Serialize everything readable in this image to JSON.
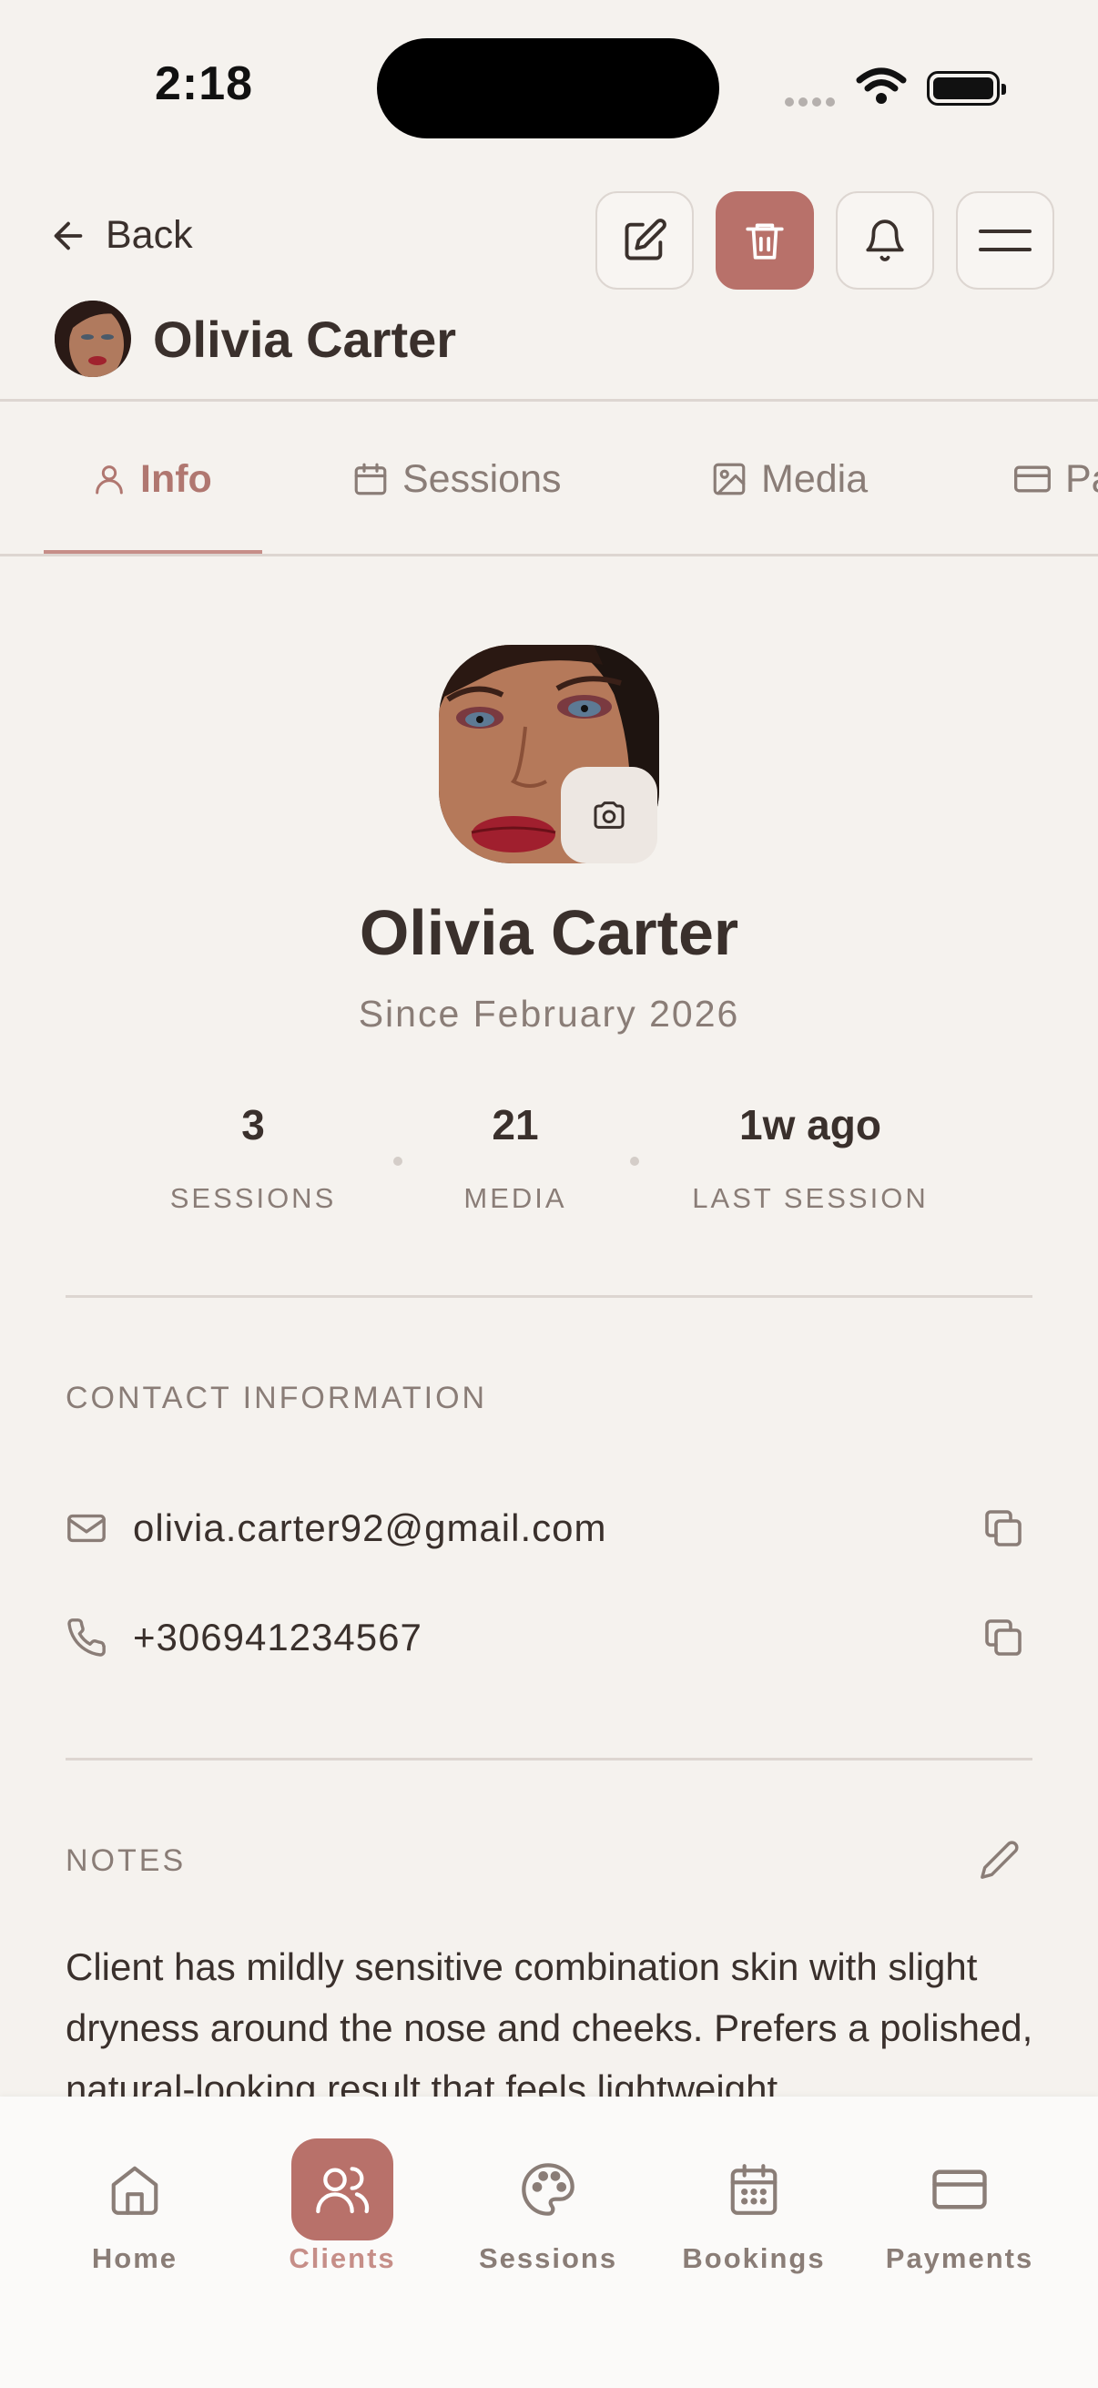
{
  "status_bar": {
    "time": "2:18"
  },
  "header": {
    "back_label": "Back",
    "client_name": "Olivia Carter",
    "actions": [
      "edit-icon",
      "trash-icon",
      "bell-icon",
      "menu-icon"
    ]
  },
  "tabs": [
    {
      "label": "Info",
      "icon": "user-icon",
      "active": true
    },
    {
      "label": "Sessions",
      "icon": "calendar-icon"
    },
    {
      "label": "Media",
      "icon": "image-icon"
    },
    {
      "label": "Pa",
      "icon": "card-icon"
    }
  ],
  "profile": {
    "name": "Olivia Carter",
    "since": "Since February 2026"
  },
  "stats": [
    {
      "value": "3",
      "label": "SESSIONS"
    },
    {
      "value": "21",
      "label": "MEDIA"
    },
    {
      "value": "1w ago",
      "label": "LAST SESSION"
    }
  ],
  "contact": {
    "title": "CONTACT INFORMATION",
    "email": "olivia.carter92@gmail.com",
    "phone": "+306941234567"
  },
  "notes": {
    "title": "NOTES",
    "text": "Client has mildly sensitive combination skin with slight dryness around the nose and cheeks. Prefers a polished, natural-looking result that feels lightweight"
  },
  "bottom_nav": [
    {
      "label": "Home",
      "icon": "home-icon"
    },
    {
      "label": "Clients",
      "icon": "users-icon",
      "active": true
    },
    {
      "label": "Sessions",
      "icon": "palette-icon"
    },
    {
      "label": "Bookings",
      "icon": "calendar-grid-icon"
    },
    {
      "label": "Payments",
      "icon": "card-icon"
    }
  ],
  "colors": {
    "accent": "#b8716a",
    "background": "#f5f2ee",
    "text": "#3a302c",
    "muted": "#8a7d77"
  }
}
